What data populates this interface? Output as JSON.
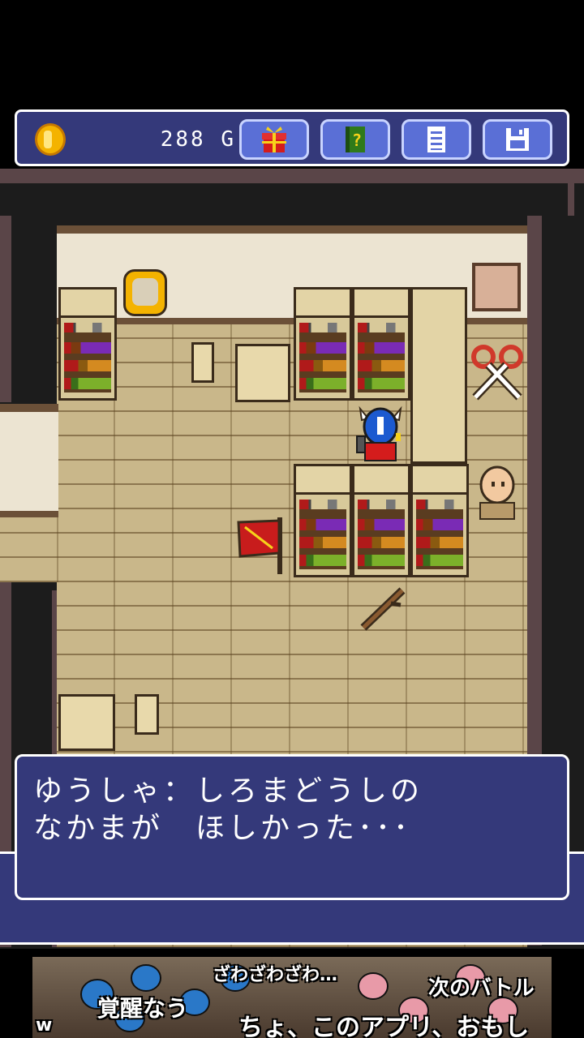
{
  "hud": {
    "gold_amount": "288",
    "gold_unit": "G",
    "buttons": [
      {
        "name": "gift-button",
        "icon": "gift-icon"
      },
      {
        "name": "help-book-button",
        "icon": "question-book-icon"
      },
      {
        "name": "menu-list-button",
        "icon": "list-icon"
      },
      {
        "name": "save-button",
        "icon": "floppy-disk-icon"
      }
    ],
    "colors": {
      "panel": "#34397a",
      "button": "#5a6fd6",
      "border": "#ffffff"
    }
  },
  "dialog": {
    "line1": "ゆうしゃ：しろまどうしの",
    "line2": "なかまが　ほしかった･･･"
  },
  "ad": {
    "caption1": "ざわざわざわ…",
    "caption2": "次のバトル",
    "caption3": "覚醒なう",
    "caption4": "ちょ、このアプリ、おもし",
    "caption5": "w"
  }
}
